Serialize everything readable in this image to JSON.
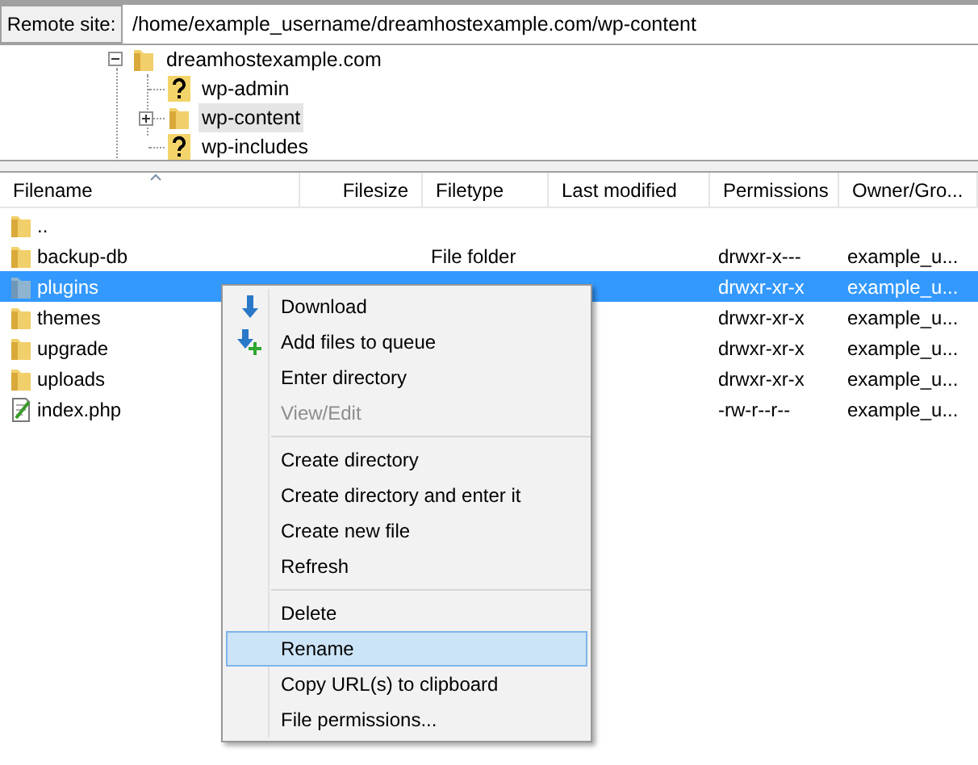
{
  "remote_site": {
    "label": "Remote site:",
    "path": "/home/example_username/dreamhostexample.com/wp-content"
  },
  "tree": {
    "label": "dreamhostexample.com",
    "kind": "folder",
    "expanded": true,
    "selected": false,
    "children": [
      {
        "label": "wp-admin",
        "kind": "unknown",
        "selected": false
      },
      {
        "label": "wp-content",
        "kind": "folder",
        "expanded": false,
        "selected": true
      },
      {
        "label": "wp-includes",
        "kind": "unknown",
        "selected": false
      }
    ]
  },
  "columns": [
    {
      "label": "Filename",
      "sorted": true
    },
    {
      "label": "Filesize",
      "sorted": false
    },
    {
      "label": "Filetype",
      "sorted": false
    },
    {
      "label": "Last modified",
      "sorted": false
    },
    {
      "label": "Permissions",
      "sorted": false
    },
    {
      "label": "Owner/Gro...",
      "sorted": false
    }
  ],
  "files": [
    {
      "name": "..",
      "kind": "folder",
      "selected": false
    },
    {
      "name": "backup-db",
      "kind": "folder",
      "filetype": "File folder",
      "permissions": "drwxr-x---",
      "owner": "example_u...",
      "selected": false
    },
    {
      "name": "plugins",
      "kind": "folder",
      "permissions": "drwxr-xr-x",
      "owner": "example_u...",
      "selected": true
    },
    {
      "name": "themes",
      "kind": "folder",
      "permissions": "drwxr-xr-x",
      "owner": "example_u...",
      "selected": false
    },
    {
      "name": "upgrade",
      "kind": "folder",
      "permissions": "drwxr-xr-x",
      "owner": "example_u...",
      "selected": false
    },
    {
      "name": "uploads",
      "kind": "folder",
      "permissions": "drwxr-xr-x",
      "owner": "example_u...",
      "selected": false
    },
    {
      "name": "index.php",
      "kind": "file",
      "permissions": "-rw-r--r--",
      "owner": "example_u...",
      "selected": false
    }
  ],
  "context_menu": [
    {
      "kind": "item",
      "label": "Download",
      "disabled": false,
      "selected": false
    },
    {
      "kind": "item",
      "label": "Add files to queue",
      "disabled": false,
      "selected": false
    },
    {
      "kind": "item",
      "label": "Enter directory",
      "disabled": false,
      "selected": false
    },
    {
      "kind": "item",
      "label": "View/Edit",
      "disabled": true,
      "selected": false
    },
    {
      "kind": "separator"
    },
    {
      "kind": "item",
      "label": "Create directory",
      "disabled": false,
      "selected": false
    },
    {
      "kind": "item",
      "label": "Create directory and enter it",
      "disabled": false,
      "selected": false
    },
    {
      "kind": "item",
      "label": "Create new file",
      "disabled": false,
      "selected": false
    },
    {
      "kind": "item",
      "label": "Refresh",
      "disabled": false,
      "selected": false
    },
    {
      "kind": "separator"
    },
    {
      "kind": "item",
      "label": "Delete",
      "disabled": false,
      "selected": false
    },
    {
      "kind": "item",
      "label": "Rename",
      "disabled": false,
      "selected": true
    },
    {
      "kind": "item",
      "label": "Copy URL(s) to clipboard",
      "disabled": false,
      "selected": false
    },
    {
      "kind": "item",
      "label": "File permissions...",
      "disabled": false,
      "selected": false
    }
  ]
}
